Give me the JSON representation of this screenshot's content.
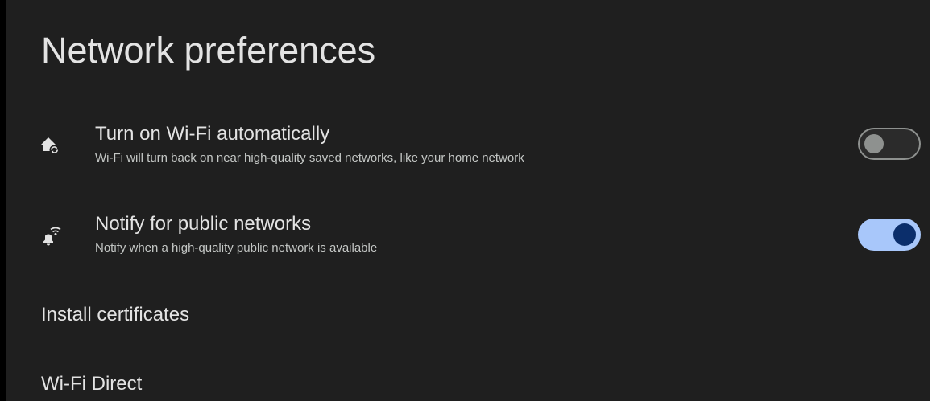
{
  "page": {
    "title": "Network preferences"
  },
  "preferences": [
    {
      "icon": "home-sync-icon",
      "title": "Turn on Wi-Fi automatically",
      "subtitle": "Wi-Fi will turn back on near high-quality saved networks, like your home network",
      "toggle_on": false
    },
    {
      "icon": "notification-wifi-icon",
      "title": "Notify for public networks",
      "subtitle": "Notify when a high-quality public network is available",
      "toggle_on": true
    }
  ],
  "items": [
    {
      "label": "Install certificates"
    },
    {
      "label": "Wi-Fi Direct"
    }
  ],
  "colors": {
    "background": "#1f1f1f",
    "text_primary": "#e3e3e3",
    "text_secondary": "#c4c7c5",
    "toggle_on_track": "#a8c7fa",
    "toggle_on_knob": "#0b2e6b",
    "toggle_off_outline": "#8e918f"
  }
}
